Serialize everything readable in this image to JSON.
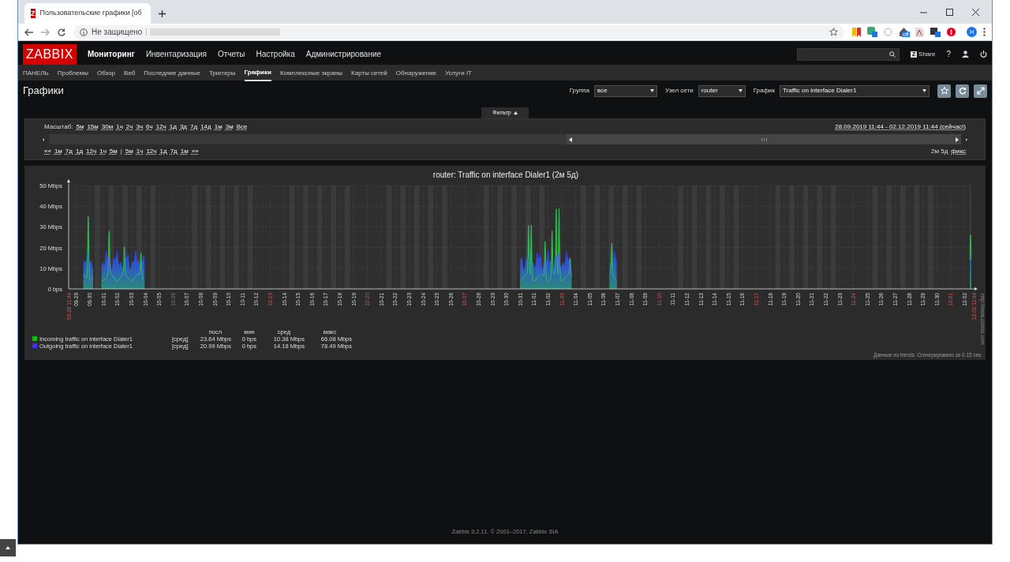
{
  "browser": {
    "favicon_letter": "Z",
    "tab_title": "Пользовательские графики [об",
    "security": "Не защищено",
    "extension_badge": "off",
    "profile_initial": "Н"
  },
  "header": {
    "logo": "ZABBIX",
    "menu": [
      {
        "label": "Мониторинг",
        "selected": true
      },
      {
        "label": "Инвентаризация",
        "selected": false
      },
      {
        "label": "Отчеты",
        "selected": false
      },
      {
        "label": "Настройка",
        "selected": false
      },
      {
        "label": "Администрирование",
        "selected": false
      }
    ],
    "share_letter": "Z",
    "share": "Share",
    "help": "?"
  },
  "subnav": [
    {
      "label": "ПАНЕЛЬ",
      "selected": false
    },
    {
      "label": "Проблемы",
      "selected": false
    },
    {
      "label": "Обзор",
      "selected": false
    },
    {
      "label": "Веб",
      "selected": false
    },
    {
      "label": "Последние данные",
      "selected": false
    },
    {
      "label": "Триггеры",
      "selected": false
    },
    {
      "label": "Графики",
      "selected": true
    },
    {
      "label": "Комплексные экраны",
      "selected": false
    },
    {
      "label": "Карты сетей",
      "selected": false
    },
    {
      "label": "Обнаружение",
      "selected": false
    },
    {
      "label": "Услуги IT",
      "selected": false
    }
  ],
  "page": {
    "title": "Графики",
    "filters": [
      {
        "label": "Группа",
        "value": "все"
      },
      {
        "label": "Узел сети",
        "value": "router"
      },
      {
        "label": "График",
        "value": "Traffic on interface Dialer1"
      }
    ]
  },
  "filter": {
    "tab": "Фильтр",
    "zoom_label": "Масштаб:",
    "zoom": [
      "5м",
      "15м",
      "30м",
      "1ч",
      "2ч",
      "3ч",
      "6ч",
      "12ч",
      "1д",
      "3д",
      "7д",
      "14д",
      "1м",
      "3м",
      "Все"
    ],
    "range": "28.09.2019 11:44 - 02.12.2019 11:44 (сейчас!)",
    "back": [
      "««",
      "1м",
      "7д",
      "1д",
      "12ч",
      "1ч",
      "5м"
    ],
    "separator": "|",
    "forward": [
      "5м",
      "1ч",
      "12ч",
      "1д",
      "7д",
      "1м",
      "»»"
    ],
    "period": "2м 5д",
    "fixed": "фикс"
  },
  "graph": {
    "title": "router: Traffic on interface Dialer1 (2м 5д)",
    "y_ticks": [
      "50 Mbps",
      "40 Mbps",
      "30 Mbps",
      "20 Mbps",
      "10 Mbps",
      "0 bps"
    ],
    "x_start": "09-28 11:44",
    "x_end": "12-02 11:44",
    "x_labels": [
      {
        "label": "09-29",
        "highlight": false
      },
      {
        "label": "09-30",
        "highlight": false
      },
      {
        "label": "10-01",
        "highlight": false
      },
      {
        "label": "10-02",
        "highlight": false
      },
      {
        "label": "10-03",
        "highlight": false
      },
      {
        "label": "10-04",
        "highlight": false
      },
      {
        "label": "10-05",
        "highlight": false
      },
      {
        "label": "10-06",
        "highlight": true
      },
      {
        "label": "10-07",
        "highlight": false
      },
      {
        "label": "10-08",
        "highlight": false
      },
      {
        "label": "10-09",
        "highlight": false
      },
      {
        "label": "10-10",
        "highlight": false
      },
      {
        "label": "10-11",
        "highlight": false
      },
      {
        "label": "10-12",
        "highlight": false
      },
      {
        "label": "10-13",
        "highlight": true
      },
      {
        "label": "10-14",
        "highlight": false
      },
      {
        "label": "10-15",
        "highlight": false
      },
      {
        "label": "10-16",
        "highlight": false
      },
      {
        "label": "10-17",
        "highlight": false
      },
      {
        "label": "10-18",
        "highlight": false
      },
      {
        "label": "10-19",
        "highlight": false
      },
      {
        "label": "10-20",
        "highlight": true
      },
      {
        "label": "10-21",
        "highlight": false
      },
      {
        "label": "10-22",
        "highlight": false
      },
      {
        "label": "10-23",
        "highlight": false
      },
      {
        "label": "10-24",
        "highlight": false
      },
      {
        "label": "10-25",
        "highlight": false
      },
      {
        "label": "10-26",
        "highlight": false
      },
      {
        "label": "10-27",
        "highlight": true
      },
      {
        "label": "10-28",
        "highlight": false
      },
      {
        "label": "10-29",
        "highlight": false
      },
      {
        "label": "10-30",
        "highlight": false
      },
      {
        "label": "10-31",
        "highlight": false
      },
      {
        "label": "11-01",
        "highlight": false
      },
      {
        "label": "11-02",
        "highlight": false
      },
      {
        "label": "11-03",
        "highlight": true
      },
      {
        "label": "11-04",
        "highlight": false
      },
      {
        "label": "11-05",
        "highlight": false
      },
      {
        "label": "11-06",
        "highlight": false
      },
      {
        "label": "11-07",
        "highlight": false
      },
      {
        "label": "11-08",
        "highlight": false
      },
      {
        "label": "11-09",
        "highlight": false
      },
      {
        "label": "11-10",
        "highlight": true
      },
      {
        "label": "11-11",
        "highlight": false
      },
      {
        "label": "11-12",
        "highlight": false
      },
      {
        "label": "11-13",
        "highlight": false
      },
      {
        "label": "11-14",
        "highlight": false
      },
      {
        "label": "11-15",
        "highlight": false
      },
      {
        "label": "11-16",
        "highlight": false
      },
      {
        "label": "11-17",
        "highlight": true
      },
      {
        "label": "11-18",
        "highlight": false
      },
      {
        "label": "11-19",
        "highlight": false
      },
      {
        "label": "11-20",
        "highlight": false
      },
      {
        "label": "11-21",
        "highlight": false
      },
      {
        "label": "11-22",
        "highlight": false
      },
      {
        "label": "11-23",
        "highlight": false
      },
      {
        "label": "11-24",
        "highlight": true
      },
      {
        "label": "11-25",
        "highlight": false
      },
      {
        "label": "11-26",
        "highlight": false
      },
      {
        "label": "11-27",
        "highlight": false
      },
      {
        "label": "11-28",
        "highlight": false
      },
      {
        "label": "11-29",
        "highlight": false
      },
      {
        "label": "11-30",
        "highlight": false
      },
      {
        "label": "12-01",
        "highlight": true
      },
      {
        "label": "12-02",
        "highlight": false
      }
    ],
    "legend_columns": [
      "посл",
      "мин",
      "сред",
      "макс"
    ],
    "series": [
      {
        "name": "Incoming traffic on interface Dialer1",
        "color": "#00c800",
        "function": "[сред]",
        "last": "23.64 Mbps",
        "min": "0 bps",
        "avg": "10.38 Mbps",
        "max": "66.08 Mbps"
      },
      {
        "name": "Outgoing traffic on interface Dialer1",
        "color": "#3333ff",
        "function": "[сред]",
        "last": "20.99 Mbps",
        "min": "0 bps",
        "avg": "14.18 Mbps",
        "max": "78.49 Mbps"
      }
    ],
    "note": "Данные из trends. Сгенерировано за 0.15 сек.",
    "side_url": "http://www.zabbix.com"
  },
  "footer": {
    "text": "Zabbix 3.2.11. © 2001–2017,",
    "link": "Zabbix SIA"
  }
}
